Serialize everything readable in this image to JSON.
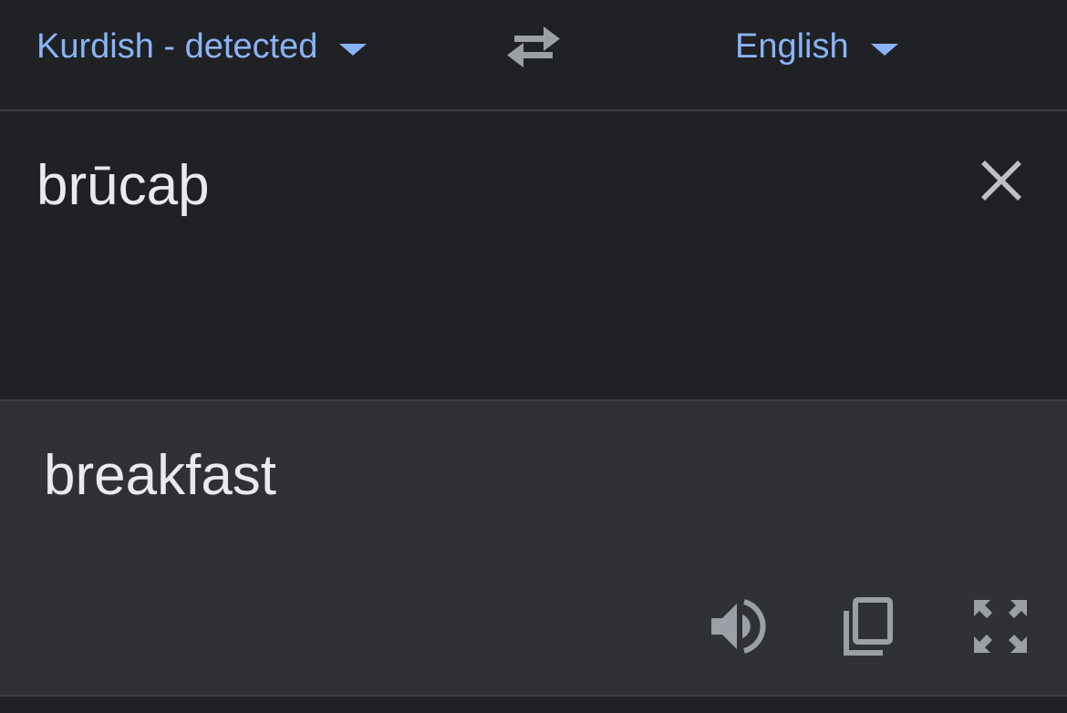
{
  "lang_bar": {
    "source_lang_label": "Kurdish - detected",
    "target_lang_label": "English",
    "accent_color": "#8ab4f8",
    "icons": {
      "source_dropdown": "caret-down-icon",
      "swap": "swap-arrows-icon",
      "target_dropdown": "caret-down-icon"
    }
  },
  "input": {
    "text": "brūcaþ",
    "clear_icon": "close-icon"
  },
  "output": {
    "text": "breakfast",
    "icons": [
      "speaker-icon",
      "copy-icon",
      "fullscreen-icon"
    ]
  },
  "colors": {
    "background": "#202124",
    "output_background": "#303134",
    "divider": "#3c4043",
    "text": "#e8eaed",
    "icon": "#9aa0a6"
  }
}
